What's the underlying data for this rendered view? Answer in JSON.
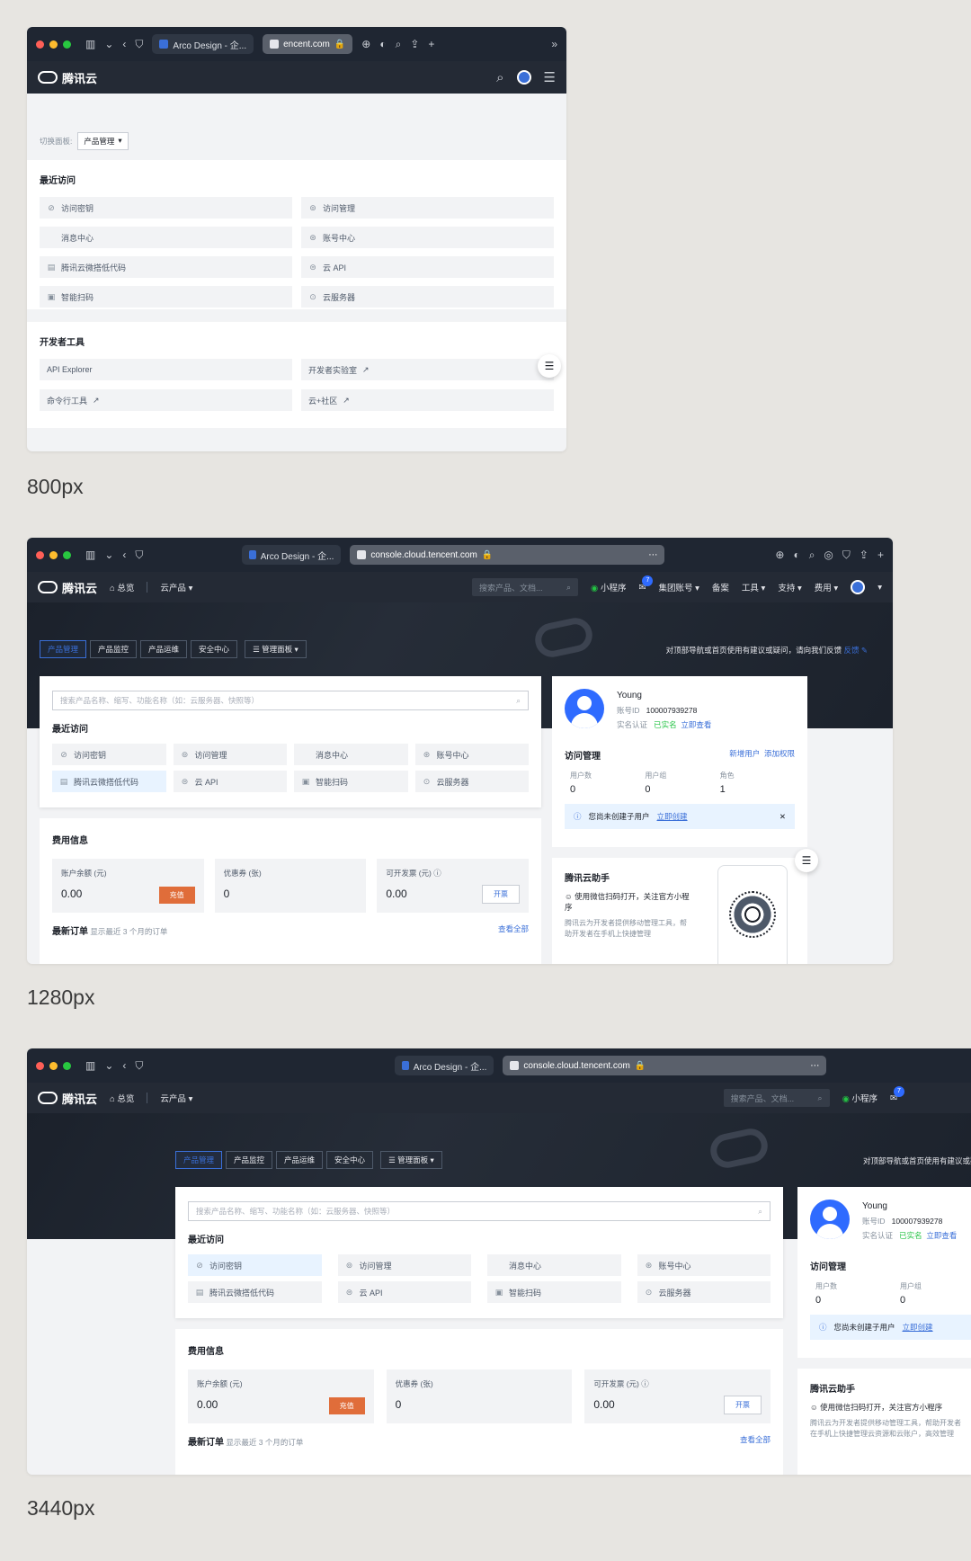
{
  "browser": {
    "tab1": "Arco Design - 企...",
    "tab2_short": "encent.com",
    "url": "console.cloud.tencent.com"
  },
  "app": {
    "brand": "腾讯云",
    "nav": {
      "overview": "总览",
      "products": "云产品"
    },
    "search_placeholder": "搜索产品、文档...",
    "miniprogram": "小程序",
    "mail_count": "7",
    "group_account": "集团账号",
    "record": "备案",
    "tools": "工具",
    "support": "支持",
    "fees": "费用"
  },
  "mobile": {
    "switch_label": "切换面板:",
    "switch_value": "产品管理",
    "recent_title": "最近访问",
    "recent": [
      "访问密钥",
      "访问管理",
      "消息中心",
      "账号中心",
      "腾讯云微搭低代码",
      "云 API",
      "智能扫码",
      "云服务器"
    ],
    "dev_title": "开发者工具",
    "dev": [
      "API Explorer",
      "开发者实验室",
      "命令行工具",
      "云+社区"
    ]
  },
  "desktop": {
    "tabs": [
      "产品管理",
      "产品监控",
      "产品运维",
      "安全中心"
    ],
    "panel": "管理面板",
    "feedback": "对顶部导航或首页使用有建议或疑问，请向我们反馈",
    "feedback_link": "反馈",
    "search_placeholder": "搜索产品名称、缩写、功能名称（如：云服务器、快照等）",
    "recent_title": "最近访问",
    "recent": [
      "访问密钥",
      "访问管理",
      "消息中心",
      "账号中心",
      "腾讯云微搭低代码",
      "云 API",
      "智能扫码",
      "云服务器"
    ],
    "fee_title": "费用信息",
    "balance_label": "账户余额 (元)",
    "balance": "0.00",
    "recharge": "充值",
    "coupon_label": "优惠券 (张)",
    "coupon": "0",
    "invoice_label": "可开发票 (元)",
    "invoice": "0.00",
    "invoice_btn": "开票",
    "orders_title": "最新订单",
    "orders_hint": "显示最近 3 个月的订单",
    "view_all": "查看全部",
    "user": {
      "name": "Young",
      "id_label": "账号ID",
      "id": "100007939278",
      "verify_label": "实名认证",
      "verified": "已实名",
      "view_now": "立即查看"
    },
    "access": {
      "title": "访问管理",
      "add_user": "新增用户",
      "add_perm": "添加权限",
      "users_label": "用户数",
      "users": "0",
      "groups_label": "用户组",
      "groups": "0",
      "roles_label": "角色",
      "roles": "1",
      "notice": "您尚未创建子用户",
      "create": "立即创建"
    },
    "assistant": {
      "title": "腾讯云助手",
      "line1": "使用微信扫码打开，关注官方小程序",
      "line2": "腾讯云为开发者提供移动管理工具，帮助开发者在手机上快捷管理云资源和云账户，高效管理",
      "line2_short": "腾讯云为开发者提供移动管理工具，帮助开发者在手机上快捷管理"
    }
  },
  "captions": {
    "c1": "800px",
    "c2": "1280px",
    "c3": "3440px"
  }
}
